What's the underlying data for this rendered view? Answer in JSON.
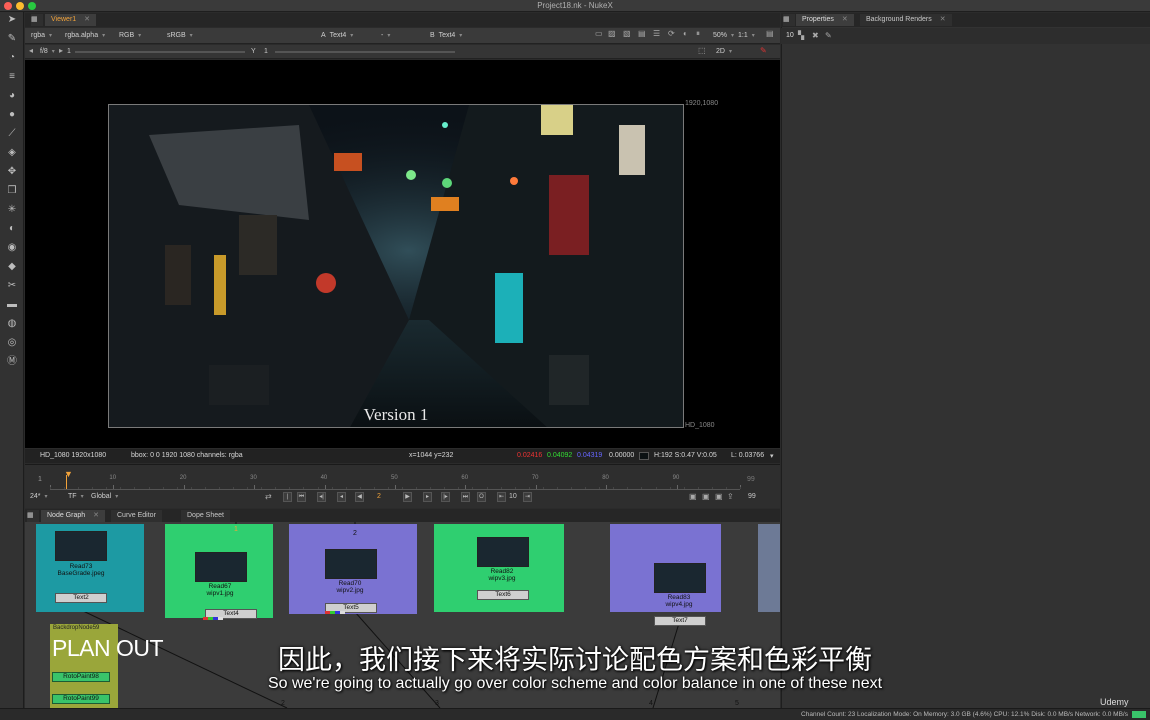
{
  "window": {
    "title": "Project18.nk - NukeX"
  },
  "viewer": {
    "tab_label": "Viewer1",
    "channels": "rgba",
    "alpha": "rgba.alpha",
    "display_channel": "RGB",
    "colorspace": "sRGB",
    "input_a": "Text4",
    "input_a_op": "-",
    "input_b": "Text4",
    "zoom": "50%",
    "ratio": "1:1",
    "mode_2d": "2D",
    "fstop": "f/8",
    "gain": "1",
    "gamma_label": "Y",
    "gamma": "1",
    "proxy": "1",
    "format_top": "1920,1080",
    "format_bottom": "HD_1080",
    "image_caption": "Version 1"
  },
  "info_bar": {
    "format": "HD_1080 1920x1080",
    "bbox": "bbox: 0 0 1920 1080 channels: rgba",
    "coords": "x=1044 y=232",
    "r": "0.02416",
    "g": "0.04092",
    "b": "0.04319",
    "a": "0.00000",
    "hsv": "H:192 S:0.47 V:0.05",
    "lum": "L: 0.03766"
  },
  "timeline": {
    "start": "1",
    "end": "99",
    "ticks": [
      "1",
      "10",
      "20",
      "30",
      "40",
      "50",
      "60",
      "70",
      "80",
      "90",
      "99"
    ],
    "fps": "24*",
    "tf": "TF",
    "global": "Global",
    "current_frame": "2",
    "increment": "10",
    "end_frame": "99"
  },
  "node_panel": {
    "tabs": [
      "Node Graph",
      "Curve Editor",
      "Dope Sheet"
    ],
    "nodes": [
      {
        "read": "Read73",
        "file": "BaseGrade.jpeg",
        "op": "Text2"
      },
      {
        "read": "Read67",
        "file": "wipv1.jpg",
        "op": "Text4"
      },
      {
        "read": "Read70",
        "file": "wipv2.jpg",
        "op": "Text5"
      },
      {
        "read": "Read82",
        "file": "wipv3.jpg",
        "op": "Text6"
      },
      {
        "read": "Read83",
        "file": "wipv4.jpg",
        "op": "Text7"
      }
    ],
    "backdrop": "BackdropNode59",
    "roto1": "RotoPaint98",
    "roto2": "RotoPaint99",
    "plan_label": "PLAN OUT",
    "pipe_nums": [
      "1",
      "2",
      "3",
      "4",
      "5"
    ]
  },
  "properties": {
    "tabs": [
      "Properties",
      "Background Renders"
    ],
    "max_panels": "10"
  },
  "status": "Channel Count: 23  Localization Mode: On  Memory: 3.0 GB (4.6%)  CPU: 12.1%  Disk: 0.0 MB/s  Network: 0.0 MB/s",
  "subtitles": {
    "cn": "因此，我们接下来将实际讨论配色方案和色彩平衡",
    "en": "So we're going to actually go over color scheme and color balance in one of these next"
  },
  "watermark": "Udemy",
  "colors": {
    "accent": "#f1a23a",
    "backdrop_teal": "#1d9aa3",
    "backdrop_green": "#2fcf70",
    "backdrop_purple": "#7a72d2"
  }
}
